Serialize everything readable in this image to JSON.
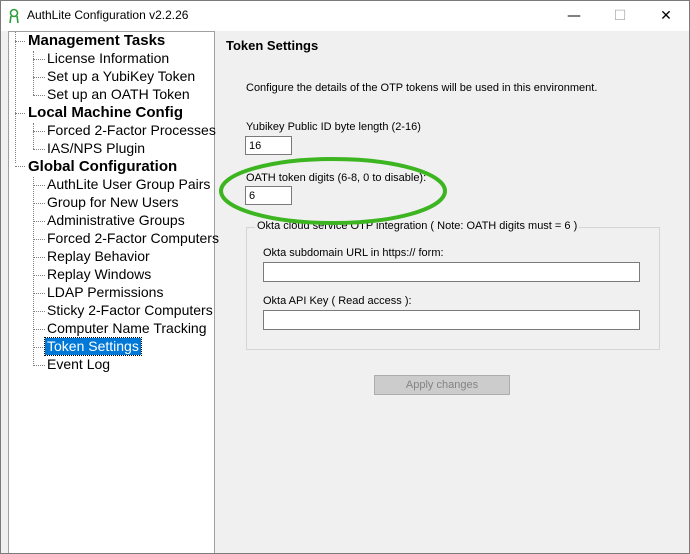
{
  "window": {
    "title": "AuthLite Configuration  v2.2.26",
    "controls": {
      "minimize": "—",
      "maximize": "☐",
      "close": "✕"
    }
  },
  "tree": {
    "groups": [
      {
        "label": "Management Tasks",
        "items": [
          "License Information",
          "Set up a YubiKey Token",
          "Set up an OATH Token"
        ]
      },
      {
        "label": "Local Machine Config",
        "items": [
          "Forced 2-Factor Processes",
          "IAS/NPS Plugin"
        ]
      },
      {
        "label": "Global Configuration",
        "items": [
          "AuthLite User Group Pairs",
          "Group for New Users",
          "Administrative Groups",
          "Forced 2-Factor Computers",
          "Replay Behavior",
          "Replay Windows",
          "LDAP Permissions",
          "Sticky 2-Factor Computers",
          "Computer Name Tracking",
          "Token Settings",
          "Event Log"
        ]
      }
    ],
    "selected": "Token Settings"
  },
  "panel": {
    "title": "Token Settings",
    "description": "Configure the details of the OTP tokens will be used in this environment.",
    "yubikey": {
      "label": "Yubikey Public ID byte length (2-16)",
      "value": "16"
    },
    "oath": {
      "label": "OATH token digits (6-8, 0 to disable):",
      "value": "6"
    },
    "okta": {
      "legend": "Okta cloud service OTP integration  ( Note: OATH digits must = 6 )",
      "subdomain_label": "Okta subdomain URL in  https://  form:",
      "subdomain_value": "",
      "apikey_label": "Okta API Key ( Read access ):",
      "apikey_value": ""
    },
    "apply_label": "Apply changes"
  },
  "colors": {
    "selection": "#0078d7",
    "highlight_ring": "#3cb521",
    "window_bg": "#f0f0f0"
  }
}
